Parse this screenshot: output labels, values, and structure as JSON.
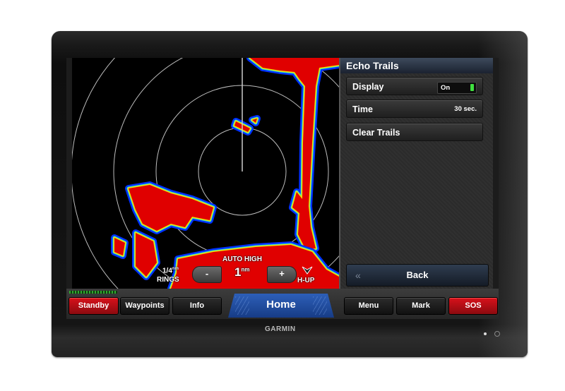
{
  "device": {
    "brand": "GARMIN"
  },
  "radar": {
    "gain_mode": "AUTO HIGH",
    "range_value": "1",
    "range_unit": "nm",
    "rings_value": "1/4",
    "rings_unit": "nm",
    "rings_label": "RINGS",
    "orientation": "H-UP",
    "zoom_out_label": "-",
    "zoom_in_label": "+",
    "colors": {
      "strong": "#e00000",
      "medium": "#f0e000",
      "weak": "#0030ff",
      "trace": "#30e0d0",
      "ring": "#bdbdbd"
    }
  },
  "panel": {
    "title": "Echo Trails",
    "items": [
      {
        "label": "Display",
        "value": "On",
        "type": "toggle"
      },
      {
        "label": "Time",
        "value": "30 sec.",
        "type": "value"
      },
      {
        "label": "Clear Trails",
        "type": "action"
      }
    ],
    "back_label": "Back",
    "back_icon": "double-chevron-left"
  },
  "bottombar": {
    "standby": "Standby",
    "waypoints": "Waypoints",
    "info": "Info",
    "home": "Home",
    "menu": "Menu",
    "mark": "Mark",
    "sos": "SOS"
  }
}
